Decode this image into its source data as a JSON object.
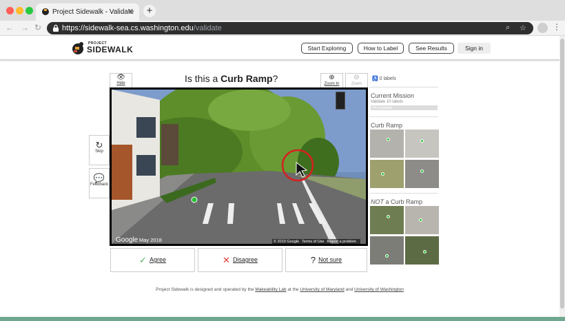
{
  "browser": {
    "tab_title": "Project Sidewalk - Validate",
    "tab_close": "✕",
    "new_tab": "+",
    "url_host": "https://sidewalk-sea.cs.washington.edu",
    "url_path": "/validate"
  },
  "header": {
    "logo_small": "PROJECT",
    "logo_big": "SIDEWALK",
    "nav": [
      {
        "label": "Start Exploring"
      },
      {
        "label": "How to Label"
      },
      {
        "label": "See Results"
      }
    ],
    "sign_in": "Sign in"
  },
  "validate": {
    "hide_label": "Hide",
    "question_prefix": "Is this a ",
    "question_label": "Curb Ramp",
    "question_suffix": "?",
    "zoom_in_label": "Zoom In",
    "zoom_out_label": "Zoom",
    "skip_label": "Skip",
    "feedback_label": "Feedback",
    "pano": {
      "google": "Google",
      "date": "May 2018",
      "copyright": "© 2019 Google",
      "terms": "Terms of Use",
      "report": "Report a problem"
    },
    "actions": {
      "agree": "Agree",
      "disagree": "Disagree",
      "not_sure": "Not sure"
    }
  },
  "panel": {
    "label_count_num": "0",
    "label_count_text": "labels",
    "mission_title": "Current Mission",
    "mission_sub": "Validate 10 labels",
    "mission_progress": "0% complete",
    "mission_progress_fraction": 0,
    "positive_title": "Curb Ramp",
    "negative_title_not": "NOT",
    "negative_title_rest": " a Curb Ramp"
  },
  "footer": {
    "prefix": "Project Sidewalk is designed and operated by the ",
    "lab": "Makeability Lab",
    "mid": " at the ",
    "umd": "University of Maryland",
    "and": " and ",
    "uw": "University of Washington"
  },
  "colors": {
    "brand": "#222222",
    "agree": "#4caf50",
    "disagree": "#e53935",
    "label_dot": "#26c134",
    "cursor_ring": "#d62020"
  }
}
